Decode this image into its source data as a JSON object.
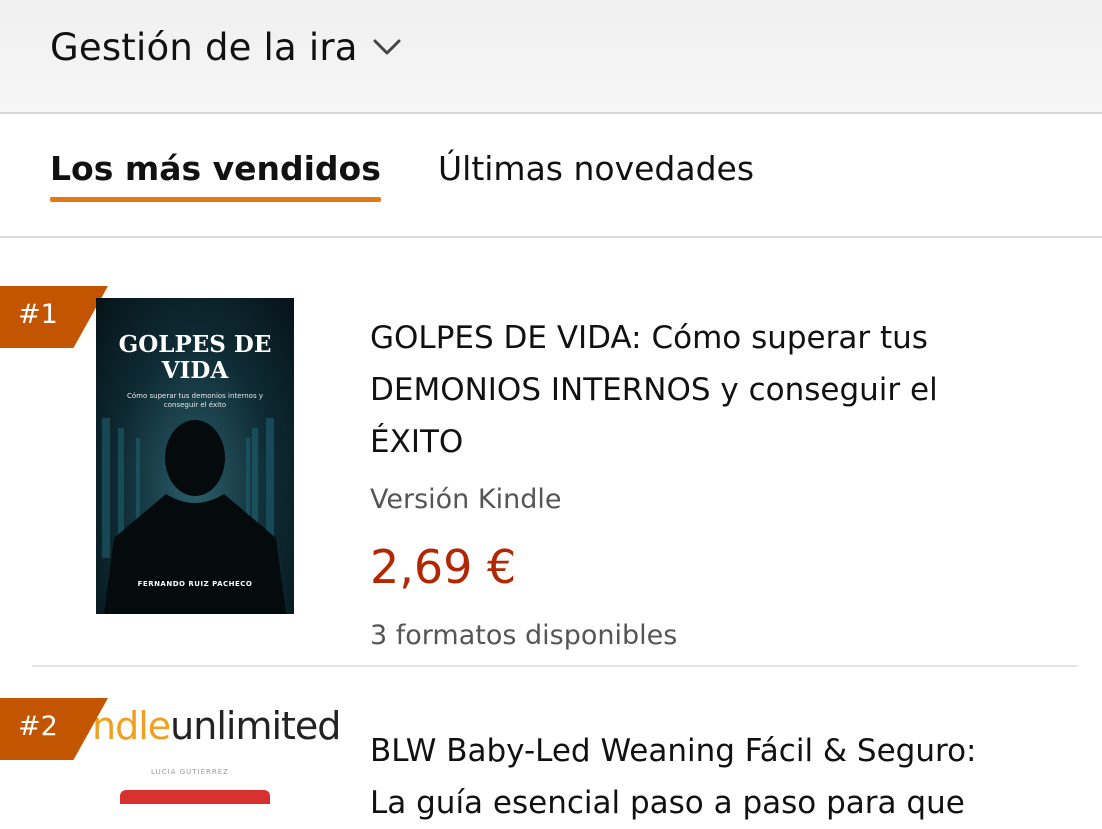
{
  "header": {
    "category_label": "Gestión de la ira",
    "chevron_icon": "chevron-down-icon"
  },
  "tabs": [
    {
      "label": "Los más vendidos",
      "active": true
    },
    {
      "label": "Últimas novedades",
      "active": false
    }
  ],
  "colors": {
    "accent": "#e47911",
    "rank_badge": "#c45500",
    "price": "#b12704"
  },
  "items": [
    {
      "rank": "#1",
      "cover": {
        "title_line1": "GOLPES DE",
        "title_line2": "VIDA",
        "subtitle": "Cómo superar tus demonios internos y conseguir el éxito",
        "author": "FERNANDO RUIZ PACHECO"
      },
      "title_lines": [
        "GOLPES DE VIDA: Cómo superar tus",
        "DEMONIOS INTERNOS y conseguir el",
        "ÉXITO"
      ],
      "format": "Versión Kindle",
      "price": "2,69 €",
      "availability": "3 formatos disponibles"
    },
    {
      "rank": "#2",
      "cover": {
        "logo_left": "ndle",
        "logo_right": "unlimited",
        "subtitle": "LUCIA GUTIERREZ"
      },
      "title_lines": [
        "BLW Baby-Led Weaning Fácil & Seguro:",
        "La guía esencial paso a paso para que"
      ]
    }
  ]
}
